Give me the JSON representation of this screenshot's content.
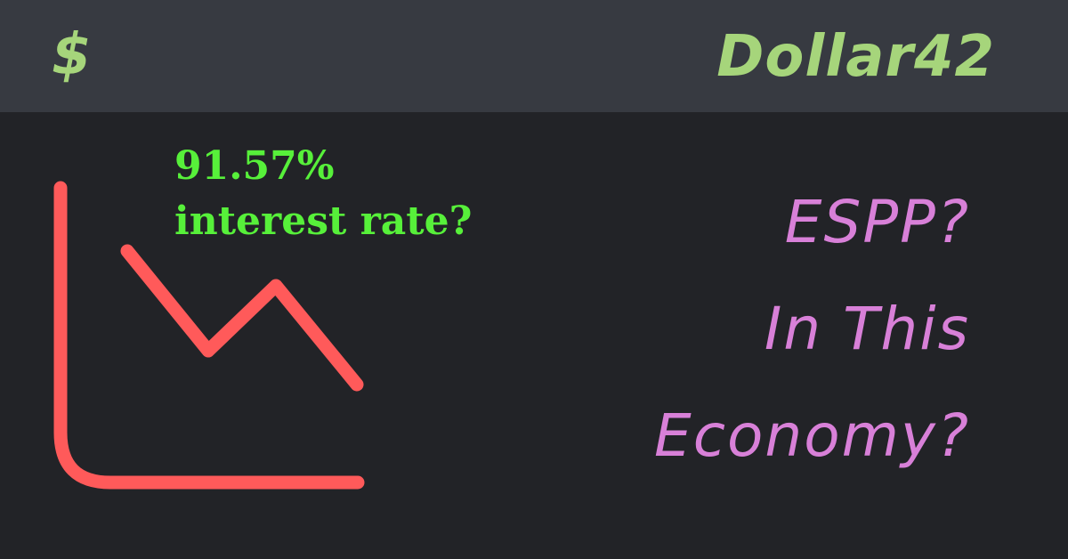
{
  "header": {
    "icon": "dollar-sign-icon",
    "icon_glyph": "$",
    "brand": "Dollar42"
  },
  "chart_icon": {
    "icon": "declining-line-chart-icon",
    "color": "#ff5a5a"
  },
  "rate": {
    "line1": "91.57%",
    "line2": "interest rate?"
  },
  "headline": {
    "line1": "ESPP?",
    "line2": "In This",
    "line3": "Economy?"
  },
  "colors": {
    "background": "#222327",
    "header": "#373a41",
    "brand_green": "#a6d57b",
    "rate_green": "#57f03a",
    "headline_pink": "#d880d8",
    "chart_red": "#ff5a5a"
  }
}
